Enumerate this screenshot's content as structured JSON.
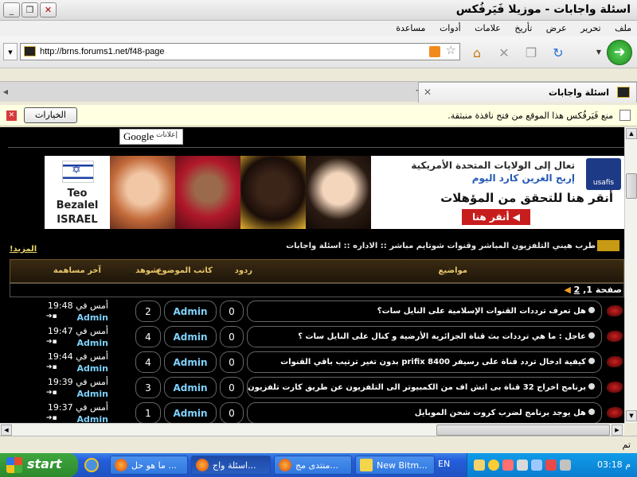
{
  "window": {
    "title": "اسئلة واجابات - موزيلا فَيَرفُكس"
  },
  "menu": [
    "ملف",
    "تحرير",
    "عرض",
    "تأريخ",
    "علامات",
    "أدوات",
    "مساعدة"
  ],
  "nav": {
    "url": "http://brns.forums1.net/f48-page"
  },
  "tab": {
    "title": "اسئلة واجابات"
  },
  "notification": {
    "text": "منع فَيَرفُكس هذا الموقع من فتح نافذة منبثقة.",
    "options_label": "الخيارات"
  },
  "ads": {
    "google_label": "Google",
    "ads_label": "إعلانات"
  },
  "banner": {
    "name_line1": "Teo",
    "name_line2": "Bezalel",
    "country": "ISRAEL",
    "line1": "تعال إلى الولايات المتحدة الأمريكية",
    "line2": "إربح الغرين كارد اليوم",
    "line3": "أنقر هنا للتحقق من المؤهلات",
    "cta": "أنقر هنا",
    "logo": "usafis"
  },
  "breadcrumb": "طرب هيني التلفزيون المباشر وقنوات شوتايم مباشر :: الاداره :: اسئلة واجابات",
  "more_link": "المزيد!",
  "table": {
    "headers": {
      "topics": "مواضيع",
      "replies": "ردود",
      "author": "كاتب الموضوع",
      "views": "شوهد",
      "last_post": "آخر مساهمة"
    },
    "pager": {
      "label": "صفحة",
      "current": "1",
      "sep": ",",
      "next": "2"
    },
    "rows": [
      {
        "topic": "هل تعرف ترددات القنوات الإسلامية على النايل سات؟",
        "replies": "0",
        "author": "Admin",
        "views": "2",
        "last_time": "أمس في 19:48",
        "last_author": "Admin"
      },
      {
        "topic": "عاجل : ما هي ترددات بث قناة الجزائرية الأرضية و كنال على النايل سات ؟",
        "replies": "0",
        "author": "Admin",
        "views": "4",
        "last_time": "أمس في 19:47",
        "last_author": "Admin"
      },
      {
        "topic": "كيفية ادخال تردد قناة على رسيفر prifix 8400 بدون تغير ترتيب باقي القنوات",
        "replies": "0",
        "author": "Admin",
        "views": "4",
        "last_time": "أمس في 19:44",
        "last_author": "Admin"
      },
      {
        "topic": "برنامج اخراج 32 قناة بى اتش اف من الكمبيوتر الى التلفزيون عن طريق كارت تلفزيون",
        "replies": "0",
        "author": "Admin",
        "views": "3",
        "last_time": "أمس في 19:39",
        "last_author": "Admin"
      },
      {
        "topic": "هل يوجد برنامج لضرب كروت شحن الموبايل",
        "replies": "0",
        "author": "Admin",
        "views": "1",
        "last_time": "أمس في 19:37",
        "last_author": "Admin"
      }
    ]
  },
  "status": {
    "text": "تم"
  },
  "taskbar": {
    "start": "start",
    "tasks": [
      "ما هو حل ...",
      "اسئلة واج...",
      "منتدى مج...",
      "New Bitm..."
    ],
    "lang": "EN",
    "clock": "03:18 م"
  }
}
